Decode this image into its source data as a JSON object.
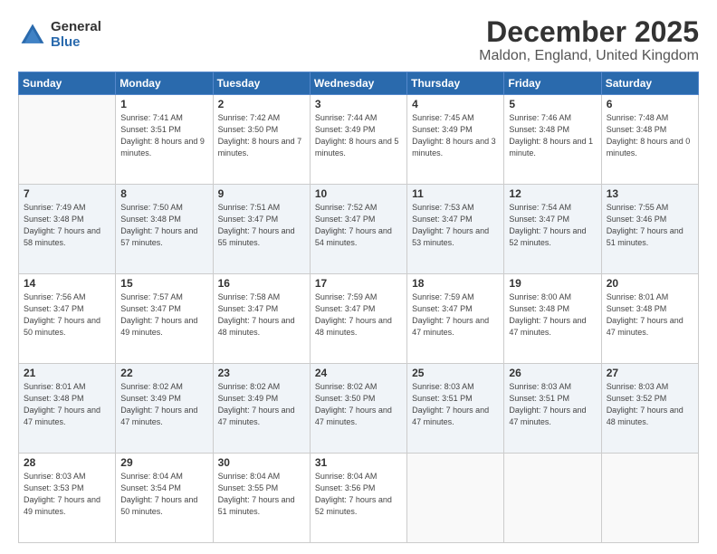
{
  "logo": {
    "general": "General",
    "blue": "Blue"
  },
  "title": "December 2025",
  "subtitle": "Maldon, England, United Kingdom",
  "weekdays": [
    "Sunday",
    "Monday",
    "Tuesday",
    "Wednesday",
    "Thursday",
    "Friday",
    "Saturday"
  ],
  "weeks": [
    [
      {
        "day": "",
        "sunrise": "",
        "sunset": "",
        "daylight": ""
      },
      {
        "day": "1",
        "sunrise": "Sunrise: 7:41 AM",
        "sunset": "Sunset: 3:51 PM",
        "daylight": "Daylight: 8 hours and 9 minutes."
      },
      {
        "day": "2",
        "sunrise": "Sunrise: 7:42 AM",
        "sunset": "Sunset: 3:50 PM",
        "daylight": "Daylight: 8 hours and 7 minutes."
      },
      {
        "day": "3",
        "sunrise": "Sunrise: 7:44 AM",
        "sunset": "Sunset: 3:49 PM",
        "daylight": "Daylight: 8 hours and 5 minutes."
      },
      {
        "day": "4",
        "sunrise": "Sunrise: 7:45 AM",
        "sunset": "Sunset: 3:49 PM",
        "daylight": "Daylight: 8 hours and 3 minutes."
      },
      {
        "day": "5",
        "sunrise": "Sunrise: 7:46 AM",
        "sunset": "Sunset: 3:48 PM",
        "daylight": "Daylight: 8 hours and 1 minute."
      },
      {
        "day": "6",
        "sunrise": "Sunrise: 7:48 AM",
        "sunset": "Sunset: 3:48 PM",
        "daylight": "Daylight: 8 hours and 0 minutes."
      }
    ],
    [
      {
        "day": "7",
        "sunrise": "Sunrise: 7:49 AM",
        "sunset": "Sunset: 3:48 PM",
        "daylight": "Daylight: 7 hours and 58 minutes."
      },
      {
        "day": "8",
        "sunrise": "Sunrise: 7:50 AM",
        "sunset": "Sunset: 3:48 PM",
        "daylight": "Daylight: 7 hours and 57 minutes."
      },
      {
        "day": "9",
        "sunrise": "Sunrise: 7:51 AM",
        "sunset": "Sunset: 3:47 PM",
        "daylight": "Daylight: 7 hours and 55 minutes."
      },
      {
        "day": "10",
        "sunrise": "Sunrise: 7:52 AM",
        "sunset": "Sunset: 3:47 PM",
        "daylight": "Daylight: 7 hours and 54 minutes."
      },
      {
        "day": "11",
        "sunrise": "Sunrise: 7:53 AM",
        "sunset": "Sunset: 3:47 PM",
        "daylight": "Daylight: 7 hours and 53 minutes."
      },
      {
        "day": "12",
        "sunrise": "Sunrise: 7:54 AM",
        "sunset": "Sunset: 3:47 PM",
        "daylight": "Daylight: 7 hours and 52 minutes."
      },
      {
        "day": "13",
        "sunrise": "Sunrise: 7:55 AM",
        "sunset": "Sunset: 3:46 PM",
        "daylight": "Daylight: 7 hours and 51 minutes."
      }
    ],
    [
      {
        "day": "14",
        "sunrise": "Sunrise: 7:56 AM",
        "sunset": "Sunset: 3:47 PM",
        "daylight": "Daylight: 7 hours and 50 minutes."
      },
      {
        "day": "15",
        "sunrise": "Sunrise: 7:57 AM",
        "sunset": "Sunset: 3:47 PM",
        "daylight": "Daylight: 7 hours and 49 minutes."
      },
      {
        "day": "16",
        "sunrise": "Sunrise: 7:58 AM",
        "sunset": "Sunset: 3:47 PM",
        "daylight": "Daylight: 7 hours and 48 minutes."
      },
      {
        "day": "17",
        "sunrise": "Sunrise: 7:59 AM",
        "sunset": "Sunset: 3:47 PM",
        "daylight": "Daylight: 7 hours and 48 minutes."
      },
      {
        "day": "18",
        "sunrise": "Sunrise: 7:59 AM",
        "sunset": "Sunset: 3:47 PM",
        "daylight": "Daylight: 7 hours and 47 minutes."
      },
      {
        "day": "19",
        "sunrise": "Sunrise: 8:00 AM",
        "sunset": "Sunset: 3:48 PM",
        "daylight": "Daylight: 7 hours and 47 minutes."
      },
      {
        "day": "20",
        "sunrise": "Sunrise: 8:01 AM",
        "sunset": "Sunset: 3:48 PM",
        "daylight": "Daylight: 7 hours and 47 minutes."
      }
    ],
    [
      {
        "day": "21",
        "sunrise": "Sunrise: 8:01 AM",
        "sunset": "Sunset: 3:48 PM",
        "daylight": "Daylight: 7 hours and 47 minutes."
      },
      {
        "day": "22",
        "sunrise": "Sunrise: 8:02 AM",
        "sunset": "Sunset: 3:49 PM",
        "daylight": "Daylight: 7 hours and 47 minutes."
      },
      {
        "day": "23",
        "sunrise": "Sunrise: 8:02 AM",
        "sunset": "Sunset: 3:49 PM",
        "daylight": "Daylight: 7 hours and 47 minutes."
      },
      {
        "day": "24",
        "sunrise": "Sunrise: 8:02 AM",
        "sunset": "Sunset: 3:50 PM",
        "daylight": "Daylight: 7 hours and 47 minutes."
      },
      {
        "day": "25",
        "sunrise": "Sunrise: 8:03 AM",
        "sunset": "Sunset: 3:51 PM",
        "daylight": "Daylight: 7 hours and 47 minutes."
      },
      {
        "day": "26",
        "sunrise": "Sunrise: 8:03 AM",
        "sunset": "Sunset: 3:51 PM",
        "daylight": "Daylight: 7 hours and 47 minutes."
      },
      {
        "day": "27",
        "sunrise": "Sunrise: 8:03 AM",
        "sunset": "Sunset: 3:52 PM",
        "daylight": "Daylight: 7 hours and 48 minutes."
      }
    ],
    [
      {
        "day": "28",
        "sunrise": "Sunrise: 8:03 AM",
        "sunset": "Sunset: 3:53 PM",
        "daylight": "Daylight: 7 hours and 49 minutes."
      },
      {
        "day": "29",
        "sunrise": "Sunrise: 8:04 AM",
        "sunset": "Sunset: 3:54 PM",
        "daylight": "Daylight: 7 hours and 50 minutes."
      },
      {
        "day": "30",
        "sunrise": "Sunrise: 8:04 AM",
        "sunset": "Sunset: 3:55 PM",
        "daylight": "Daylight: 7 hours and 51 minutes."
      },
      {
        "day": "31",
        "sunrise": "Sunrise: 8:04 AM",
        "sunset": "Sunset: 3:56 PM",
        "daylight": "Daylight: 7 hours and 52 minutes."
      },
      {
        "day": "",
        "sunrise": "",
        "sunset": "",
        "daylight": ""
      },
      {
        "day": "",
        "sunrise": "",
        "sunset": "",
        "daylight": ""
      },
      {
        "day": "",
        "sunrise": "",
        "sunset": "",
        "daylight": ""
      }
    ]
  ]
}
